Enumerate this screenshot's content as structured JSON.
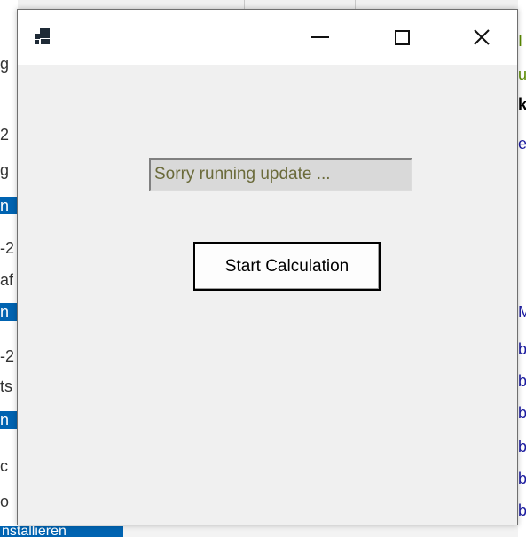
{
  "window": {
    "app_icon": "app-icon",
    "minimize_icon": "minimize-icon",
    "maximize_icon": "maximize-icon",
    "close_icon": "close-icon",
    "close_glyph": "✕"
  },
  "main": {
    "status_text": "Sorry running update ...",
    "start_button_label": "Start Calculation"
  },
  "background": {
    "left_fragments": [
      "g",
      "2",
      "g",
      "n",
      "-2",
      "af",
      "n",
      "-2",
      "ts",
      "n",
      "c",
      "o"
    ],
    "right_fragments": [
      "I",
      "u",
      "k",
      "e",
      "M",
      "b",
      "b",
      "b",
      "b",
      "b",
      "b"
    ],
    "bottom_tab": "nstallieren"
  },
  "colors": {
    "selection": "#0063b1",
    "status_text": "#6b6b3b"
  }
}
